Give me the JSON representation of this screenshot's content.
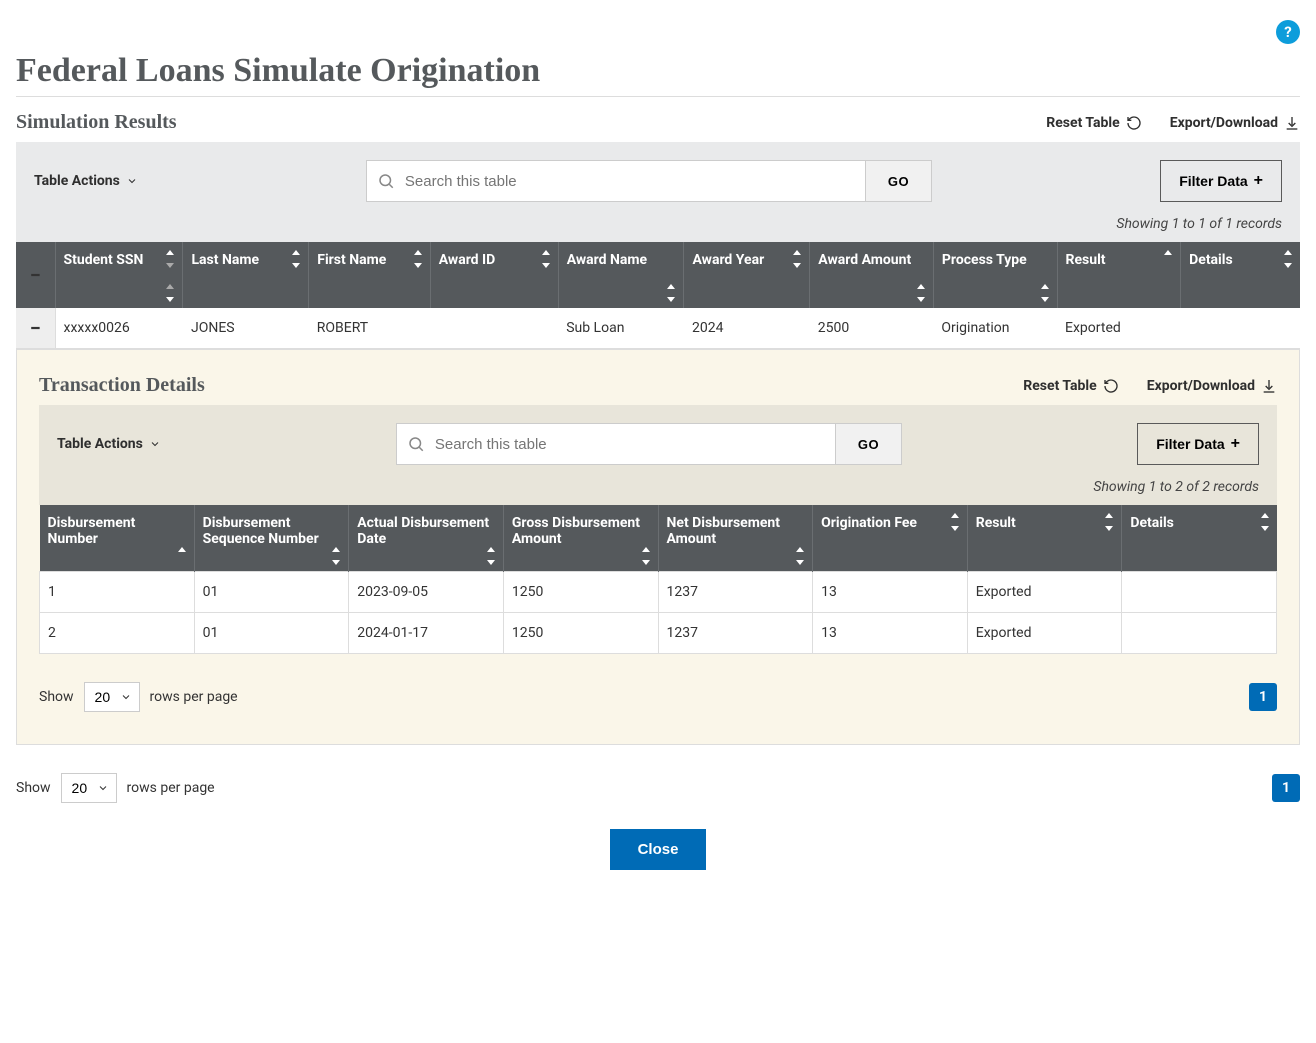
{
  "help_glyph": "?",
  "page_title": "Federal Loans Simulate Origination",
  "main": {
    "heading": "Simulation Results",
    "reset_label": "Reset Table",
    "export_label": "Export/Download",
    "table_actions_label": "Table Actions",
    "search_placeholder": "Search this table",
    "go_label": "GO",
    "filter_label": "Filter Data",
    "records_text": "Showing 1 to 1 of 1 records",
    "columns": [
      "Student SSN",
      "Last Name",
      "First Name",
      "Award ID",
      "Award Name",
      "Award Year",
      "Award Amount",
      "Process Type",
      "Result",
      "Details"
    ],
    "rows": [
      {
        "student_ssn": "xxxxx0026",
        "last_name": "JONES",
        "first_name": "ROBERT",
        "award_id": "",
        "award_name": "Sub Loan",
        "award_year": "2024",
        "award_amount": "2500",
        "process_type": "Origination",
        "result": "Exported",
        "details": ""
      }
    ],
    "pager": {
      "show_label": "Show",
      "page_size": "20",
      "rows_label": "rows per page",
      "current_page": "1"
    }
  },
  "detail": {
    "heading": "Transaction Details",
    "reset_label": "Reset Table",
    "export_label": "Export/Download",
    "table_actions_label": "Table Actions",
    "search_placeholder": "Search this table",
    "go_label": "GO",
    "filter_label": "Filter Data",
    "records_text": "Showing 1 to 2 of 2 records",
    "columns": [
      "Disbursement Number",
      "Disbursement Sequence Number",
      "Actual Disbursement Date",
      "Gross Disbursement Amount",
      "Net Disbursement Amount",
      "Origination Fee",
      "Result",
      "Details"
    ],
    "rows": [
      {
        "num": "1",
        "seq": "01",
        "date": "2023-09-05",
        "gross": "1250",
        "net": "1237",
        "fee": "13",
        "result": "Exported",
        "details": ""
      },
      {
        "num": "2",
        "seq": "01",
        "date": "2024-01-17",
        "gross": "1250",
        "net": "1237",
        "fee": "13",
        "result": "Exported",
        "details": ""
      }
    ],
    "pager": {
      "show_label": "Show",
      "page_size": "20",
      "rows_label": "rows per page",
      "current_page": "1"
    }
  },
  "close_label": "Close"
}
